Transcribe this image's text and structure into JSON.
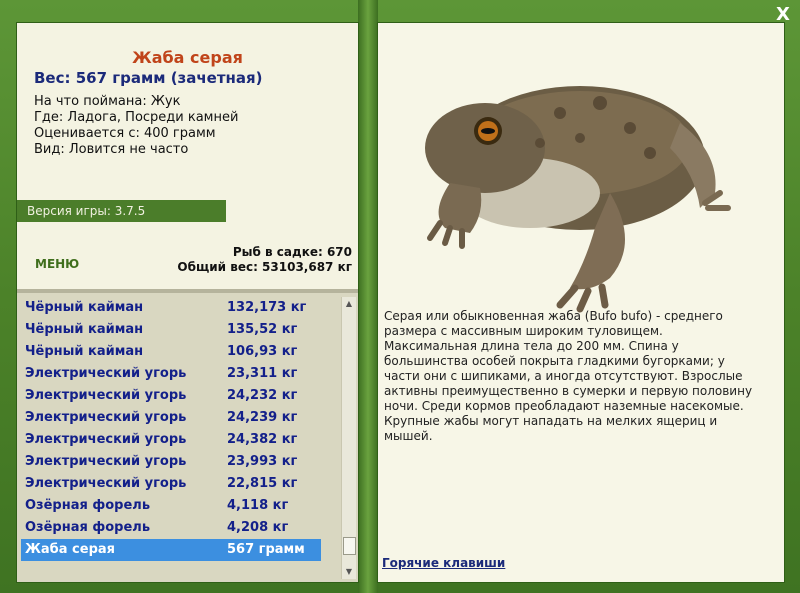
{
  "window": {
    "close_label": "X"
  },
  "catch": {
    "name": "Жаба серая",
    "weight": "Вес: 567 грамм (зачетная)",
    "bait": "На что поймана: Жук",
    "place": "Где: Ладога, Посреди камней",
    "valued": "Оценивается с: 400 грамм",
    "rarity": "Вид: Ловится не часто"
  },
  "version": "Версия игры: 3.7.5",
  "menu_label": "МЕНЮ",
  "stats": {
    "fish_count": "Рыб в садке: 670",
    "total_weight": "Общий вес: 53103,687 кг"
  },
  "fish_list": [
    {
      "name": "Чёрный кайман",
      "weight": "132,173 кг"
    },
    {
      "name": "Чёрный кайман",
      "weight": "135,52 кг"
    },
    {
      "name": "Чёрный кайман",
      "weight": "106,93 кг"
    },
    {
      "name": "Электрический угорь",
      "weight": "23,311 кг"
    },
    {
      "name": "Электрический угорь",
      "weight": "24,232 кг"
    },
    {
      "name": "Электрический угорь",
      "weight": "24,239 кг"
    },
    {
      "name": "Электрический угорь",
      "weight": "24,382 кг"
    },
    {
      "name": "Электрический угорь",
      "weight": "23,993 кг"
    },
    {
      "name": "Электрический угорь",
      "weight": "22,815 кг"
    },
    {
      "name": "Озёрная форель",
      "weight": "4,118 кг"
    },
    {
      "name": "Озёрная форель",
      "weight": "4,208 кг"
    },
    {
      "name": "Жаба серая",
      "weight": "567 грамм"
    }
  ],
  "selected_index": 11,
  "description": "Серая или обыкновенная жаба (Bufo bufo) - среднего размера с массивным широким туловищем. Максимальная длина тела до 200 мм. Спина у большинства особей покрыта гладкими бугорками; у части они с шипиками, а иногда отсутствуют. Взрослые активны преимущественно в сумерки и первую половину ночи. Среди кормов преобладают наземные насекомые. Крупные жабы могут нападать на мелких ящериц и мышей.",
  "hotkeys_label": "Горячие клавиши",
  "colors": {
    "frame_green": "#4f8a2e",
    "panel_bg": "#f4f3e2",
    "list_bg": "#d9d7c1",
    "name_orange": "#c0441a",
    "text_blue": "#1b2a7a",
    "selection_blue": "#3c8fe0"
  }
}
